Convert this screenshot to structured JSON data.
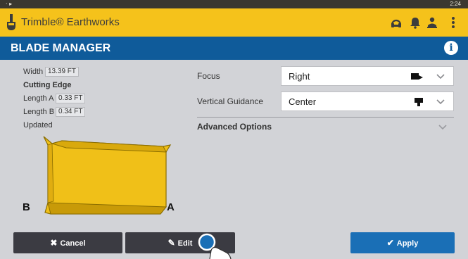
{
  "status_bar": {
    "left_icons": "· ▸",
    "time": "2:24"
  },
  "app_bar": {
    "brand": "Trimble® Earthworks",
    "icons": [
      "headset-icon",
      "bell-icon",
      "operator-icon",
      "overflow-menu-icon"
    ]
  },
  "title_bar": {
    "title": "BLADE MANAGER",
    "info_icon": "i"
  },
  "blade_info": {
    "width_label": "Width",
    "width_value": "13.39 FT",
    "cutting_edge_label": "Cutting Edge",
    "length_a_label": "Length A",
    "length_a_value": "0.33 FT",
    "length_b_label": "Length B",
    "length_b_value": "0.34 FT",
    "updated_label": "Updated",
    "point_b": "B",
    "point_a": "A",
    "blade_color": "#f5c21b"
  },
  "settings": {
    "focus_label": "Focus",
    "focus_value": "Right",
    "vertical_guidance_label": "Vertical Guidance",
    "vertical_guidance_value": "Center",
    "advanced_options_label": "Advanced Options"
  },
  "buttons": {
    "cancel": "Cancel",
    "cancel_icon": "✖",
    "edit": "Edit",
    "edit_icon": "✎",
    "apply": "Apply",
    "apply_icon": "✔"
  },
  "colors": {
    "header": "#f5c21b",
    "title_bar": "#0f5b9a",
    "apply": "#1a6fb6",
    "button_dark": "#3b3b42",
    "background": "#d2d3d7"
  }
}
